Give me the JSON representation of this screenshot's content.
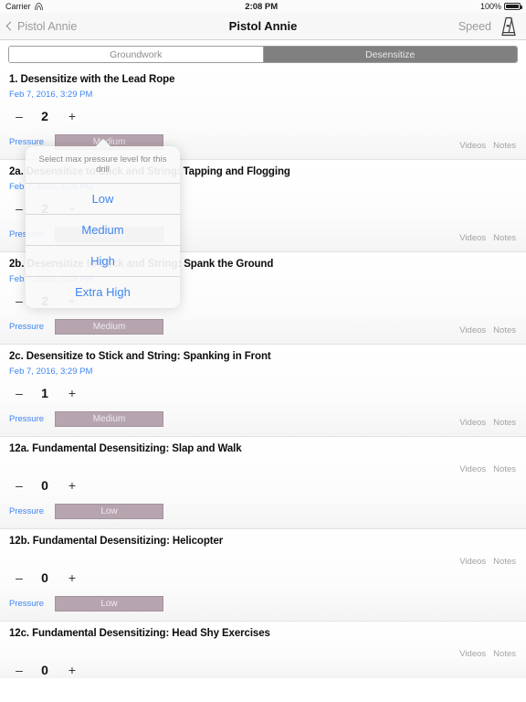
{
  "status_bar": {
    "carrier": "Carrier",
    "wifi_icon": "wifi-icon",
    "time": "2:08 PM",
    "battery_percent": "100%",
    "battery_icon": "battery-full-icon"
  },
  "nav_bar": {
    "back_label": "Pistol Annie",
    "back_icon": "chevron-left-icon",
    "title": "Pistol Annie",
    "speed_label": "Speed",
    "metronome_icon": "metronome-icon"
  },
  "segmented_control": {
    "options": [
      {
        "label": "Groundwork",
        "selected": false
      },
      {
        "label": "Desensitize",
        "selected": true
      }
    ]
  },
  "list_labels": {
    "videos": "Videos",
    "notes": "Notes",
    "pressure": "Pressure",
    "minus": "–",
    "plus": "+"
  },
  "drills": [
    {
      "title": "1. Desensitize with the Lead Rope",
      "date": "Feb 7, 2016, 3:29 PM",
      "count": "2",
      "pressure": "Medium"
    },
    {
      "title": "2a. Desensitize to Stick and String:  Tapping and Flogging",
      "date": "Feb 7, 2016, 3:29 PM",
      "count": "2",
      "pressure": "Medium"
    },
    {
      "title": "2b. Desensitize to Stick and String:  Spank the Ground",
      "date": "Feb 7, 2016, 3:29 PM",
      "count": "2",
      "pressure": "Medium"
    },
    {
      "title": "2c. Desensitize to Stick and String:  Spanking in Front",
      "date": "Feb 7, 2016, 3:29 PM",
      "count": "1",
      "pressure": "Medium"
    },
    {
      "title": "12a. Fundamental Desensitizing: Slap and Walk",
      "date": "",
      "count": "0",
      "pressure": "Low"
    },
    {
      "title": "12b. Fundamental Desensitizing: Helicopter",
      "date": "",
      "count": "0",
      "pressure": "Low"
    },
    {
      "title": "12c. Fundamental Desensitizing: Head Shy Exercises",
      "date": "",
      "count": "0",
      "pressure": ""
    }
  ],
  "popover": {
    "title": "Select max pressure level for this drill",
    "items": [
      {
        "label": "Low"
      },
      {
        "label": "Medium"
      },
      {
        "label": "High"
      },
      {
        "label": "Extra High"
      }
    ]
  },
  "colors": {
    "accent_blue": "#3f86f3",
    "segment_selected": "#808080",
    "pressure_bar": "#b6a4af"
  }
}
